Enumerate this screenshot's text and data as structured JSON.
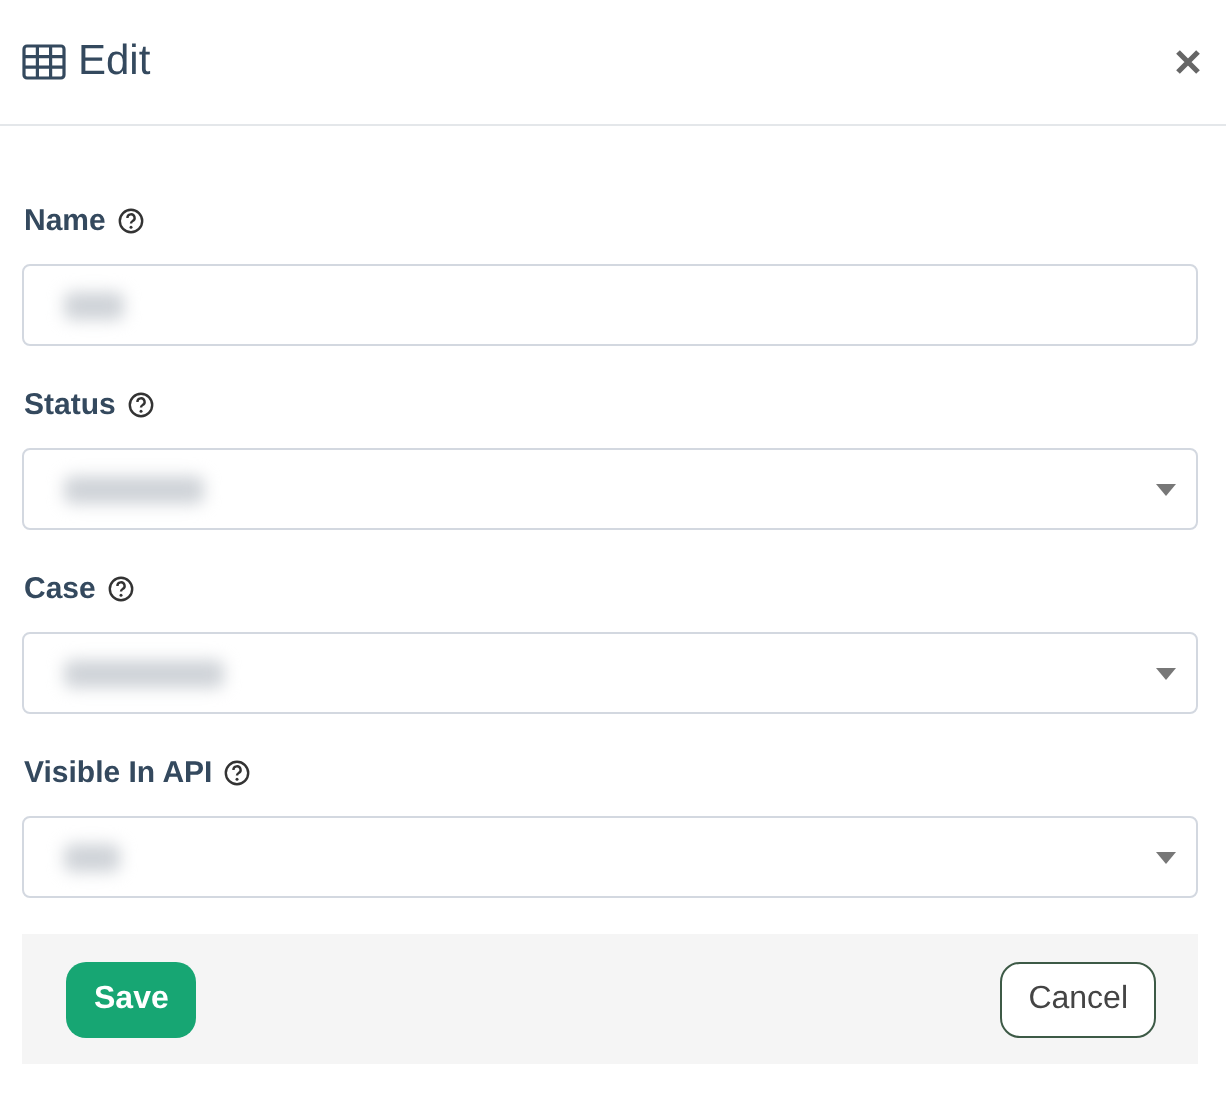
{
  "dialog": {
    "title": "Edit"
  },
  "fields": [
    {
      "label": "Name",
      "kind": "text",
      "redacted": true
    },
    {
      "label": "Status",
      "kind": "select",
      "redacted": true
    },
    {
      "label": "Case",
      "kind": "select",
      "redacted": true
    },
    {
      "label": "Visible In API",
      "kind": "select",
      "redacted": true
    }
  ],
  "buttons": [
    {
      "label": "Save",
      "kind": "primary"
    },
    {
      "label": "Cancel",
      "kind": "secondary"
    }
  ]
}
